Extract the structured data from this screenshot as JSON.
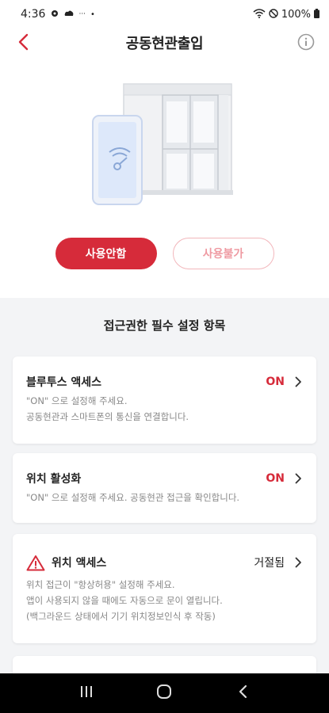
{
  "status_bar": {
    "time": "4:36",
    "battery": "100%",
    "dots": "···",
    "bullet": "•"
  },
  "header": {
    "title": "공동현관출입"
  },
  "actions": {
    "primary_label": "사용안함",
    "secondary_label": "사용불가"
  },
  "settings": {
    "section_title": "접근권한 필수 설정 항목",
    "items": [
      {
        "title": "블루투스 액세스",
        "status": "ON",
        "desc": [
          "\"ON\" 으로 설정해 주세요.",
          "공동현관과 스마트폰의 통신을 연결합니다."
        ]
      },
      {
        "title": "위치 활성화",
        "status": "ON",
        "desc": [
          "\"ON\" 으로 설정해 주세요. 공동현관 접근을 확인합니다."
        ]
      },
      {
        "title": "위치 액세스",
        "status": "거절됨",
        "desc": [
          "위치 접근이 \"항상허용\" 설정해 주세요.",
          "앱이 사용되지 않을 때에도 자동으로 문이 열립니다.",
          "(백그라운드 상태에서 기기 위치정보인식 후 작동)"
        ]
      }
    ]
  },
  "colors": {
    "accent": "#d62b3a",
    "accent_light": "#f2b6bb",
    "settings_bg": "#f3f4f6"
  },
  "icons": {
    "back": "chevron-left-icon",
    "info": "info-icon",
    "warning": "warning-icon",
    "nav_recent": "recent-apps-icon",
    "nav_home": "home-icon",
    "nav_back": "nav-back-icon"
  }
}
